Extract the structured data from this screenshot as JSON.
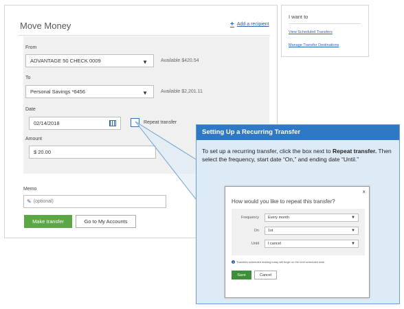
{
  "move_money": {
    "title": "Move Money",
    "add_recipient": "Add a recipient",
    "from_label": "From",
    "from_value": "ADVANTAGE 50 CHECK 0009",
    "from_available": "Available $420.54",
    "to_label": "To",
    "to_value": "Personal Savings *6456",
    "to_available": "Available $2,201.11",
    "date_label": "Date",
    "date_value": "02/14/2018",
    "repeat_label": "Repeat transfer",
    "amount_label": "Amount",
    "amount_value": "$  20.00",
    "memo_label": "Memo",
    "memo_placeholder": "(optional)",
    "make_transfer": "Make transfer",
    "go_accounts": "Go to My Accounts"
  },
  "i_want_to": {
    "title": "I want to",
    "links": [
      "View Scheduled Transfers",
      "Manage Transfer Destinations"
    ]
  },
  "callout": {
    "title": "Setting Up a Recurring Transfer",
    "text_1": "To set up a recurring transfer, click the box next to ",
    "text_bold": "Repeat transfer.",
    "text_2": " Then select the frequency, start date “On,” and ending date “Until.”"
  },
  "modal": {
    "close": "×",
    "title": "How would you like to repeat this transfer?",
    "frequency_label": "Frequency",
    "frequency_value": "Every month",
    "on_label": "On",
    "on_value": "1st",
    "until_label": "Until",
    "until_value": "I cancel",
    "info": "Transfers scheduled starting today will begin on the next scheduled date.",
    "save": "Save",
    "cancel": "Cancel"
  },
  "colors": {
    "primary_green": "#5ba745",
    "link_blue": "#2b5ea8",
    "callout_header": "#2f78c4",
    "callout_bg": "#ddebf7"
  }
}
